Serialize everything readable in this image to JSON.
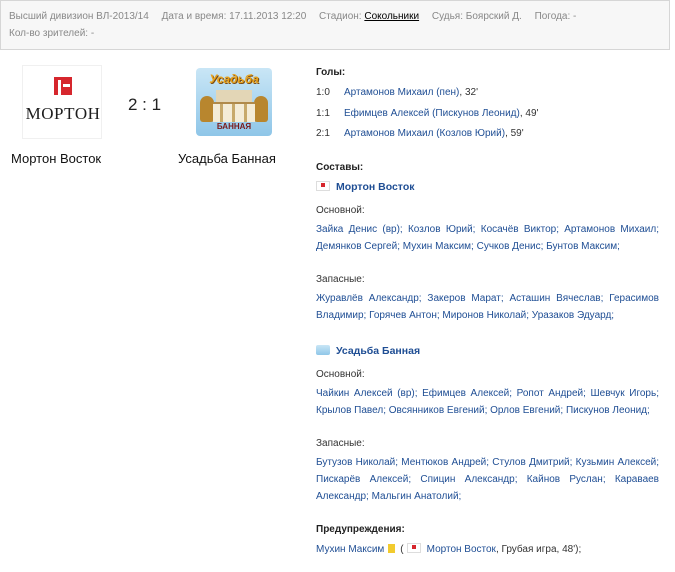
{
  "info": {
    "division": "Высший дивизион ВЛ-2013/14",
    "datetime_label": "Дата и время:",
    "datetime_value": "17.11.2013 12:20",
    "stadium_label": "Стадион:",
    "stadium_value": "Сокольники",
    "referee_label": "Судья:",
    "referee_value": "Боярский Д.",
    "weather_label": "Погода:",
    "weather_value": "-",
    "spectators_label": "Кол-во зрителей:",
    "spectators_value": "-"
  },
  "match": {
    "home_logo_text": "МОРТОН",
    "away_logo_text": "Усадьба",
    "away_logo_sub": "БАННАЯ",
    "score": "2 : 1",
    "home_team": "Мортон Восток",
    "away_team": "Усадьба Банная"
  },
  "goals": {
    "heading": "Голы:",
    "items": [
      {
        "score": "1:0",
        "text": "Артамонов Михаил (пен)",
        "minute": ", 32'"
      },
      {
        "score": "1:1",
        "text": "Ефимцев Алексей (Пискунов Леонид)",
        "minute": ", 49'"
      },
      {
        "score": "2:1",
        "text": "Артамонов Михаил (Козлов Юрий)",
        "minute": ", 59'"
      }
    ]
  },
  "lineups": {
    "heading": "Составы:",
    "home": {
      "name": "Мортон Восток",
      "main_label": "Основной:",
      "main": "Зайка Денис (вр); Козлов Юрий; Косачёв Виктор; Артамонов Михаил; Демянков Сергей; Мухин Максим; Сучков Денис; Бунтов Максим;",
      "subs_label": "Запасные:",
      "subs": "Журавлёв Александр; Закеров Марат; Асташин Вячеслав; Герасимов Владимир; Горячев Антон; Миронов Николай; Уразаков Эдуард;"
    },
    "away": {
      "name": "Усадьба Банная",
      "main_label": "Основной:",
      "main": "Чайкин Алексей (вр); Ефимцев Алексей; Ропот Андрей; Шевчук Игорь; Крылов Павел; Овсянников Евгений; Орлов Евгений; Пискунов Леонид;",
      "subs_label": "Запасные:",
      "subs": "Бутузов Николай; Ментюков Андрей; Стулов Дмитрий; Кузьмин Алексей; Пискарёв Алексей; Спицин Александр; Кайнов Руслан; Караваев Александр; Мальгин Анатолий;"
    }
  },
  "warnings": {
    "heading": "Предупреждения:",
    "player": "Мухин Максим",
    "open": "(",
    "team": "Мортон Восток",
    "reason": ", Грубая игра, 48');"
  },
  "colors": {
    "link": "#1f4e94",
    "yellow_card": "#f2cb2e",
    "brand_red": "#d6262d"
  }
}
